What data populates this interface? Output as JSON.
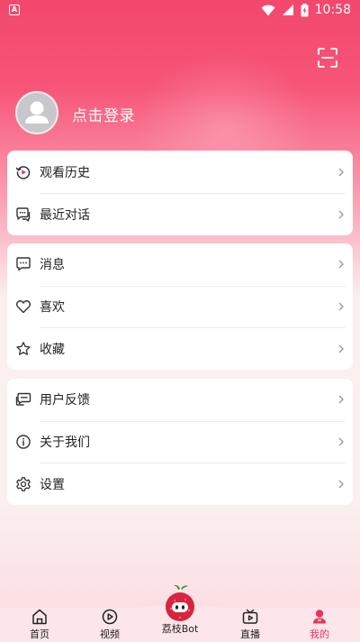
{
  "status_bar": {
    "time": "10:58",
    "app_icon_letter": "A"
  },
  "profile": {
    "login_label": "点击登录"
  },
  "groups": [
    {
      "items": [
        {
          "label": "观看历史",
          "icon": "history-icon"
        },
        {
          "label": "最近对话",
          "icon": "chat-icon"
        }
      ]
    },
    {
      "items": [
        {
          "label": "消息",
          "icon": "message-icon"
        },
        {
          "label": "喜欢",
          "icon": "heart-icon"
        },
        {
          "label": "收藏",
          "icon": "star-icon"
        }
      ]
    },
    {
      "items": [
        {
          "label": "用户反馈",
          "icon": "feedback-icon"
        },
        {
          "label": "关于我们",
          "icon": "info-icon"
        },
        {
          "label": "设置",
          "icon": "settings-icon"
        }
      ]
    }
  ],
  "tabs": [
    {
      "label": "首页",
      "icon": "home-icon",
      "active": false
    },
    {
      "label": "视频",
      "icon": "video-icon",
      "active": false
    },
    {
      "label": "荔枝Bot",
      "icon": "lychee-bot-icon",
      "active": false
    },
    {
      "label": "直播",
      "icon": "live-icon",
      "active": false
    },
    {
      "label": "我的",
      "icon": "profile-icon",
      "active": true
    }
  ],
  "colors": {
    "accent": "#e8345b",
    "header": "#f3476c"
  }
}
